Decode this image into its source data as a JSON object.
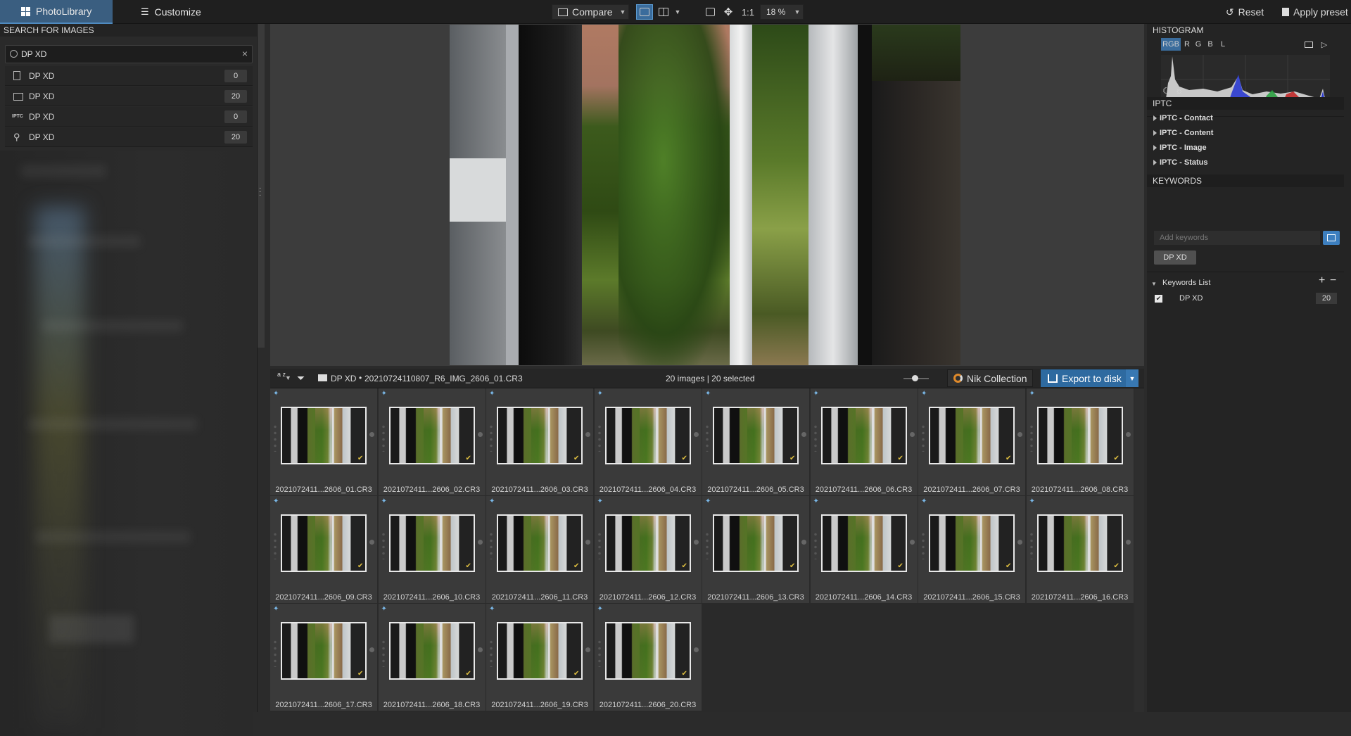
{
  "topbar": {
    "tab_library": "PhotoLibrary",
    "tab_customize": "Customize",
    "compare_label": "Compare",
    "ratio_label": "1:1",
    "zoom_value": "18 %",
    "reset_label": "Reset",
    "apply_preset_label": "Apply preset"
  },
  "search": {
    "section_title": "SEARCH FOR IMAGES",
    "query": "DP XD",
    "results": [
      {
        "icon": "file-icon",
        "label": "DP XD",
        "count": "0"
      },
      {
        "icon": "folder-icon",
        "label": "DP XD",
        "count": "20"
      },
      {
        "icon": "iptc-icon",
        "label": "DP XD",
        "count": "0"
      },
      {
        "icon": "keyword-icon",
        "label": "DP XD",
        "count": "20"
      }
    ]
  },
  "filmstrip": {
    "sort_label": "a z",
    "folder_name": "DP XD",
    "current_file": "20210724110807_R6_IMG_2606_01.CR3",
    "status": "20 images | 20 selected",
    "nik_label": "Nik Collection",
    "export_label": "Export to disk"
  },
  "thumbnails": [
    "2021072411...2606_01.CR3",
    "2021072411...2606_02.CR3",
    "2021072411...2606_03.CR3",
    "2021072411...2606_04.CR3",
    "2021072411...2606_05.CR3",
    "2021072411...2606_06.CR3",
    "2021072411...2606_07.CR3",
    "2021072411...2606_08.CR3",
    "2021072411...2606_09.CR3",
    "2021072411...2606_10.CR3",
    "2021072411...2606_11.CR3",
    "2021072411...2606_12.CR3",
    "2021072411...2606_13.CR3",
    "2021072411...2606_14.CR3",
    "2021072411...2606_15.CR3",
    "2021072411...2606_16.CR3",
    "2021072411...2606_17.CR3",
    "2021072411...2606_18.CR3",
    "2021072411...2606_19.CR3",
    "2021072411...2606_20.CR3"
  ],
  "histogram": {
    "title": "HISTOGRAM",
    "channels": [
      "RGB",
      "R",
      "G",
      "B",
      "L"
    ],
    "active_channel": "RGB"
  },
  "iptc": {
    "title": "IPTC",
    "groups": [
      "IPTC - Contact",
      "IPTC - Content",
      "IPTC - Image",
      "IPTC - Status"
    ]
  },
  "keywords": {
    "title": "KEYWORDS",
    "input_placeholder": "Add keywords",
    "tag": "DP XD",
    "list_title": "Keywords List",
    "list_items": [
      {
        "label": "DP XD",
        "count": "20",
        "checked": true
      }
    ]
  },
  "colors": {
    "accent": "#3d7fbf",
    "tab_active": "#3a5e80",
    "check": "#e0c040"
  }
}
